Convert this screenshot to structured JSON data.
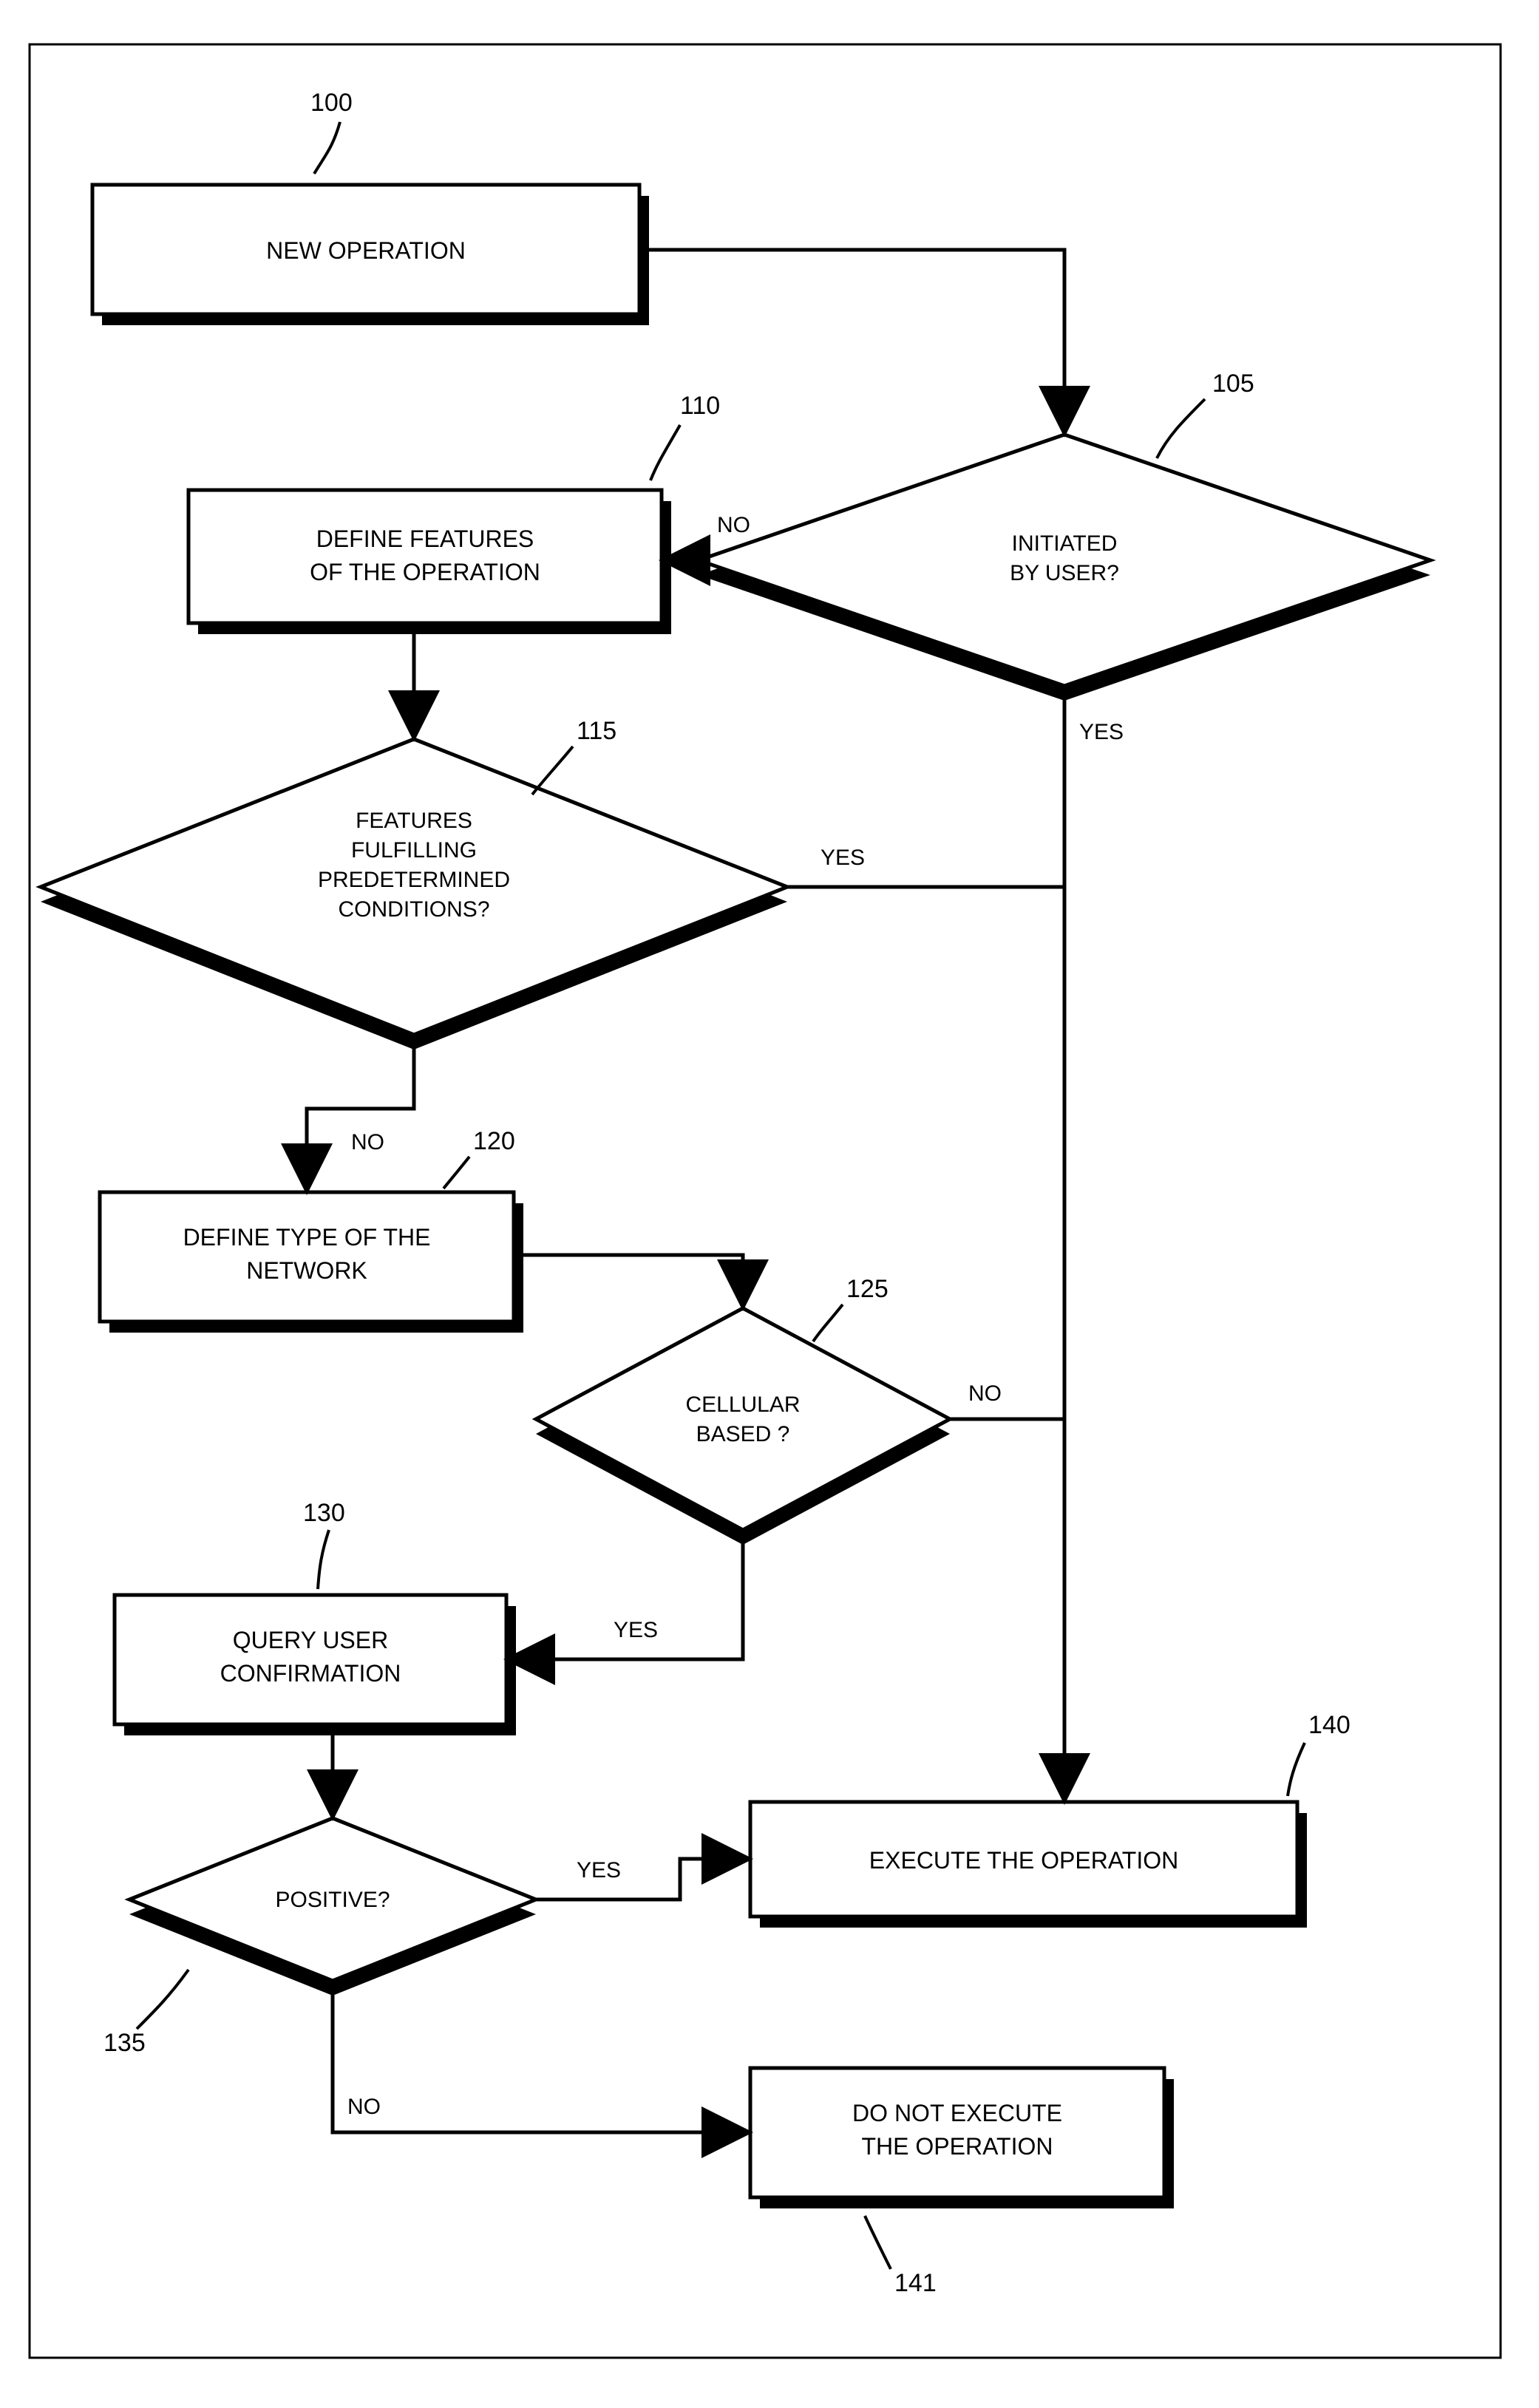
{
  "refs": {
    "n100": "100",
    "n105": "105",
    "n110": "110",
    "n115": "115",
    "n120": "120",
    "n125": "125",
    "n130": "130",
    "n135": "135",
    "n140": "140",
    "n141": "141"
  },
  "nodes": {
    "n100": {
      "lines": [
        "NEW OPERATION"
      ]
    },
    "n105": {
      "lines": [
        "INITIATED",
        "BY USER?"
      ]
    },
    "n110": {
      "lines": [
        "DEFINE FEATURES",
        "OF THE OPERATION"
      ]
    },
    "n115": {
      "lines": [
        "FEATURES",
        "FULFILLING",
        "PREDETERMINED",
        "CONDITIONS?"
      ]
    },
    "n120": {
      "lines": [
        "DEFINE TYPE OF THE",
        "NETWORK"
      ]
    },
    "n125": {
      "lines": [
        "CELLULAR",
        "BASED ?"
      ]
    },
    "n130": {
      "lines": [
        "QUERY USER",
        "CONFIRMATION"
      ]
    },
    "n135": {
      "lines": [
        "POSITIVE?"
      ]
    },
    "n140": {
      "lines": [
        "EXECUTE THE OPERATION"
      ]
    },
    "n141": {
      "lines": [
        "DO NOT EXECUTE",
        "THE OPERATION"
      ]
    }
  },
  "edges": {
    "yes": "YES",
    "no": "NO"
  }
}
